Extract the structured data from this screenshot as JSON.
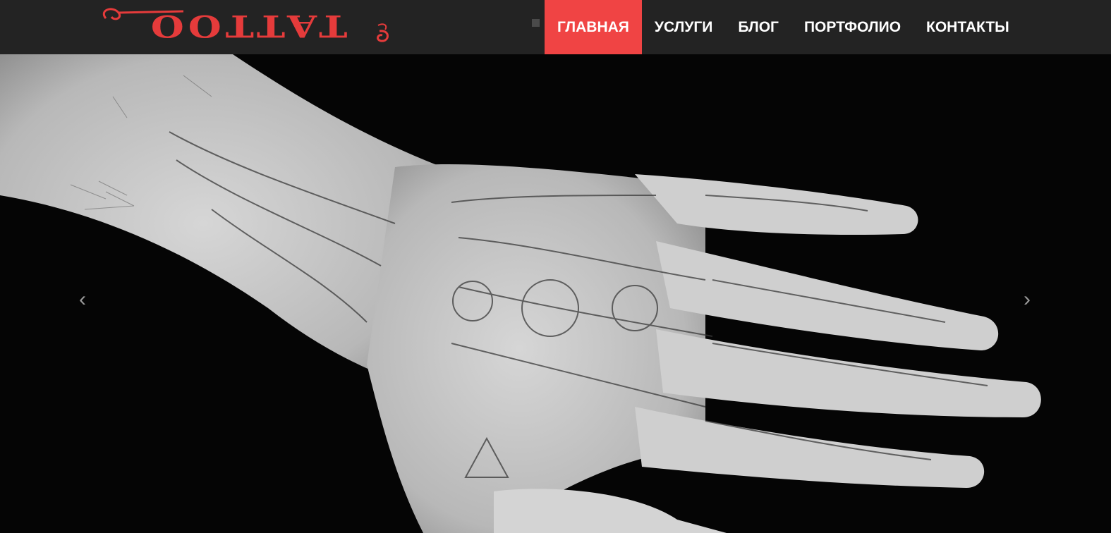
{
  "brand": {
    "logo_text": "TATTOO",
    "accent": "#e53b3b"
  },
  "nav": {
    "items": [
      {
        "label": "ГЛАВНАЯ",
        "active": true
      },
      {
        "label": "УСЛУГИ",
        "active": false
      },
      {
        "label": "БЛОГ",
        "active": false
      },
      {
        "label": "ПОРТФОЛИО",
        "active": false
      },
      {
        "label": "КОНТАКТЫ",
        "active": false
      }
    ],
    "active_color": "#f04444",
    "bar_color": "#232323"
  },
  "hero": {
    "image": "skeleton-hand-tattoo-photo",
    "prev_icon": "chevron-left-icon",
    "next_icon": "chevron-right-icon",
    "prev_glyph": "‹",
    "next_glyph": "›"
  }
}
